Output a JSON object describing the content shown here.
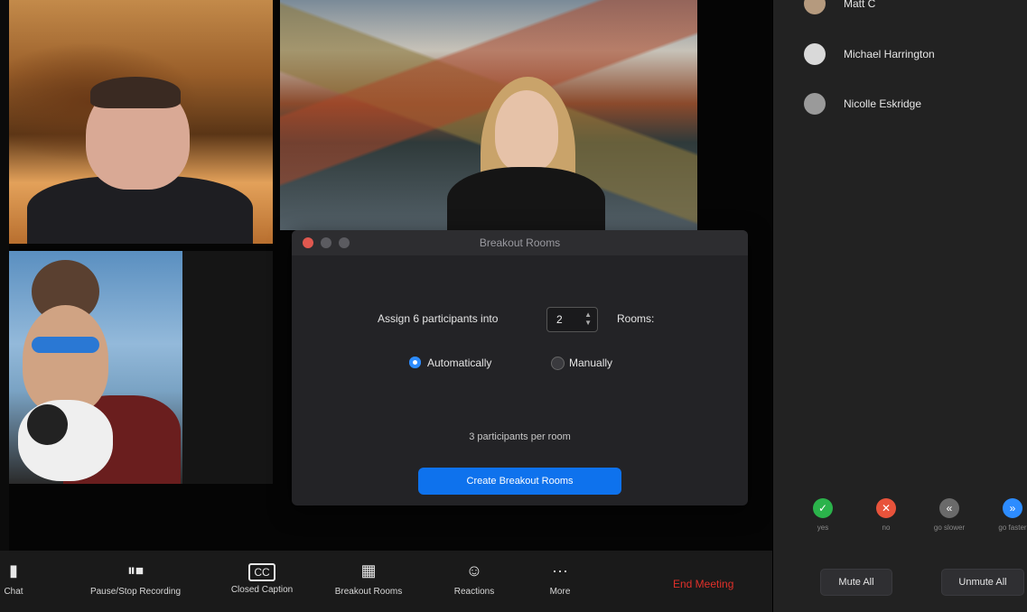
{
  "colors": {
    "accent_blue": "#0e72ed",
    "end_meeting_red": "#e0302a",
    "yes_green": "#2bb34b",
    "no_red": "#e8533b",
    "slower_gray": "#6a6a6a",
    "faster_blue": "#2d8cff"
  },
  "dialog": {
    "title": "Breakout Rooms",
    "assign_text": "Assign 6 participants into",
    "rooms_value": "2",
    "rooms_label": "Rooms:",
    "option_auto": "Automatically",
    "option_manual": "Manually",
    "selected_option": "Automatically",
    "per_room_text": "3 participants per room",
    "create_button": "Create Breakout Rooms"
  },
  "toolbar": {
    "items": [
      {
        "label": "Chat",
        "icon": "chat-icon"
      },
      {
        "label": "Pause/Stop Recording",
        "icon": "pause-stop-recording-icon"
      },
      {
        "label": "Closed Caption",
        "icon": "closed-caption-icon"
      },
      {
        "label": "Breakout Rooms",
        "icon": "breakout-rooms-icon"
      },
      {
        "label": "Reactions",
        "icon": "reactions-icon"
      },
      {
        "label": "More",
        "icon": "more-icon"
      }
    ],
    "end_meeting": "End Meeting"
  },
  "participants": {
    "list": [
      {
        "name": "Matt C"
      },
      {
        "name": "Michael Harrington"
      },
      {
        "name": "Nicolle Eskridge"
      }
    ],
    "feedback": [
      {
        "label": "yes",
        "icon": "check-icon",
        "glyph": "✓"
      },
      {
        "label": "no",
        "icon": "x-icon",
        "glyph": "✕"
      },
      {
        "label": "go slower",
        "icon": "rewind-icon",
        "glyph": "«"
      },
      {
        "label": "go faster",
        "icon": "fast-forward-icon",
        "glyph": "»"
      }
    ],
    "mute_all": "Mute All",
    "unmute_all": "Unmute All"
  }
}
